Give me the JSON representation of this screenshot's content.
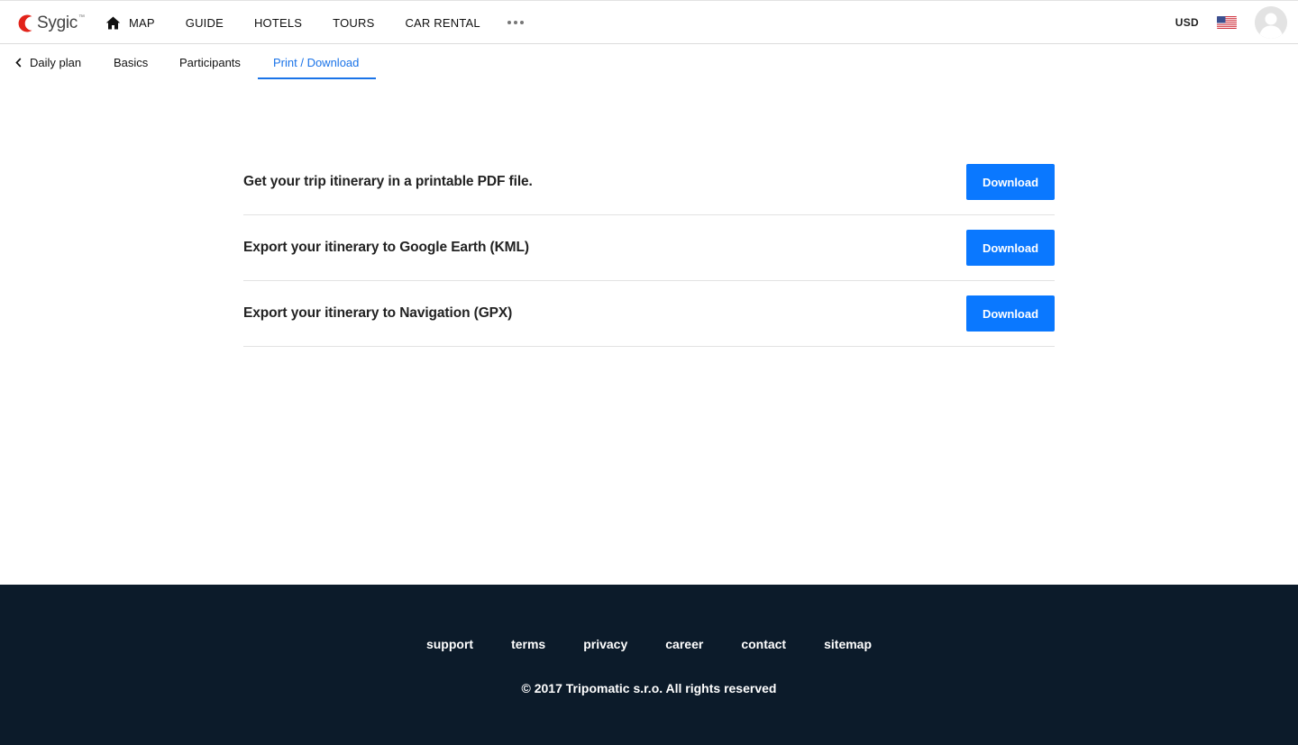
{
  "header": {
    "logo_text": "Sygic",
    "logo_icon": "sygic-logo",
    "brand_color": "#e2231a",
    "nav_items": [
      {
        "label": "MAP",
        "icon": "home-icon"
      },
      {
        "label": "GUIDE"
      },
      {
        "label": "HOTELS"
      },
      {
        "label": "TOURS"
      },
      {
        "label": "CAR RENTAL"
      }
    ],
    "more_icon": "more-horizontal-icon",
    "currency": "USD",
    "language_flag": "us-flag-icon",
    "avatar_icon": "user-avatar-icon"
  },
  "subnav": {
    "back_label": "Daily plan",
    "tabs": [
      {
        "label": "Basics",
        "active": false
      },
      {
        "label": "Participants",
        "active": false
      },
      {
        "label": "Print / Download",
        "active": true
      }
    ],
    "active_color": "#1a73e8"
  },
  "downloads": [
    {
      "text": "Get your trip itinerary in a printable PDF file.",
      "button": "Download"
    },
    {
      "text": "Export your itinerary to Google Earth (KML)",
      "button": "Download"
    },
    {
      "text": "Export your itinerary to Navigation (GPX)",
      "button": "Download"
    }
  ],
  "button_color": "#0a78ff",
  "footer": {
    "background": "#0c1b2a",
    "links": [
      "support",
      "terms",
      "privacy",
      "career",
      "contact",
      "sitemap"
    ],
    "copyright": "© 2017 Tripomatic s.r.o. All rights reserved"
  }
}
